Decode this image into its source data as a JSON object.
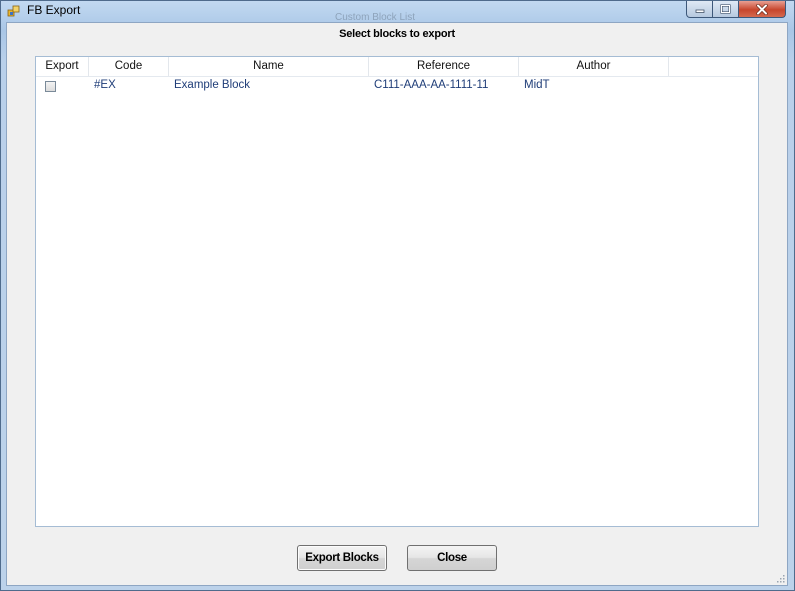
{
  "window": {
    "title": "FB Export",
    "ghost_title": "Custom Block List",
    "controls": {
      "minimize_icon": "minimize-icon",
      "maximize_icon": "maximize-icon",
      "close_icon": "close-icon"
    }
  },
  "dialog": {
    "heading": "Select blocks to export"
  },
  "list": {
    "columns": [
      "Export",
      "Code",
      "Name",
      "Reference",
      "Author"
    ],
    "rows": [
      {
        "checked": false,
        "code": "#EX",
        "name": "Example Block",
        "reference": "C111-AAA-AA-1111-11",
        "author": "MidT"
      }
    ]
  },
  "buttons": {
    "export_label": "Export Blocks",
    "close_label": "Close"
  }
}
